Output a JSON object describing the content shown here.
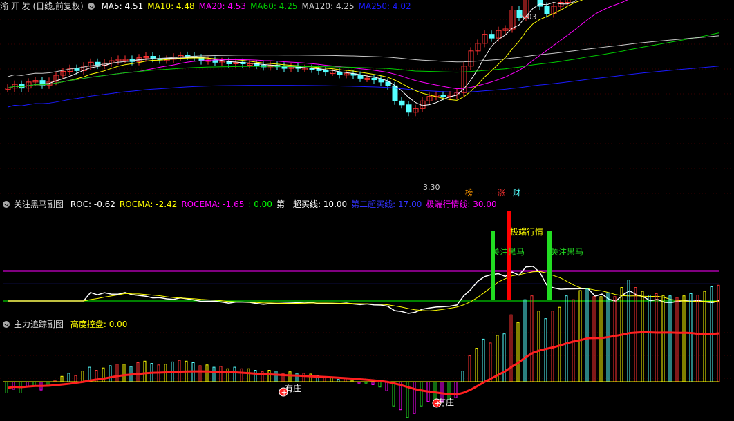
{
  "colors": {
    "up": "#ff3232",
    "down": "#54ffff",
    "ma5": "#ffffff",
    "ma10": "#ffff00",
    "ma20": "#ff00ff",
    "ma60": "#00cc00",
    "ma120": "#c8c8c8",
    "ma250": "#1a1aff",
    "axis": "#3a0000"
  },
  "panel1": {
    "title": "渝 开 发 (日线,前复权)",
    "indicators": [
      {
        "label": "MA5:",
        "value": "4.51",
        "color": "#ffffff"
      },
      {
        "label": "MA10:",
        "value": "4.48",
        "color": "#ffff00"
      },
      {
        "label": "MA20:",
        "value": "4.53",
        "color": "#ff00ff"
      },
      {
        "label": "MA60:",
        "value": "4.25",
        "color": "#00cc00"
      },
      {
        "label": "MA120:",
        "value": "4.25",
        "color": "#c8c8c8"
      },
      {
        "label": "MA250:",
        "value": "4.02",
        "color": "#1a1aff"
      }
    ],
    "high_label": "5.03",
    "low_label": "3.30",
    "tags": [
      {
        "text": "榜",
        "color": "#ff9a00"
      },
      {
        "text": "涨",
        "color": "#ff3232"
      },
      {
        "text": "财",
        "color": "#54ffff"
      }
    ]
  },
  "panel2": {
    "title": "关注黑马副图",
    "indicators": [
      {
        "label": "ROC:",
        "value": "-0.62",
        "color": "#ffffff"
      },
      {
        "label": "ROCMA:",
        "value": "-2.42",
        "color": "#ffff00"
      },
      {
        "label": "ROCEMA:",
        "value": "-1.65",
        "color": "#ff00ff"
      },
      {
        "label": ":",
        "value": "0.00",
        "color": "#00ff00"
      },
      {
        "label": "第一超买线:",
        "value": "10.00",
        "color": "#ffffff"
      },
      {
        "label": "第二超买线:",
        "value": "17.00",
        "color": "#3333ff"
      },
      {
        "label": "极端行情线:",
        "value": "30.00",
        "color": "#ff00ff"
      }
    ],
    "annotations": [
      {
        "text": "关注黑马",
        "color": "#22dd22"
      },
      {
        "text": "极端行情",
        "color": "#ffff00"
      },
      {
        "text": "关注黑马",
        "color": "#22dd22"
      }
    ]
  },
  "panel3": {
    "title": "主力追踪副图",
    "indicators": [
      {
        "label": "高度控盘:",
        "value": "0.00",
        "color": "#ffff00"
      }
    ],
    "labels": [
      {
        "text": "有庄"
      },
      {
        "text": "有庄"
      }
    ]
  }
}
